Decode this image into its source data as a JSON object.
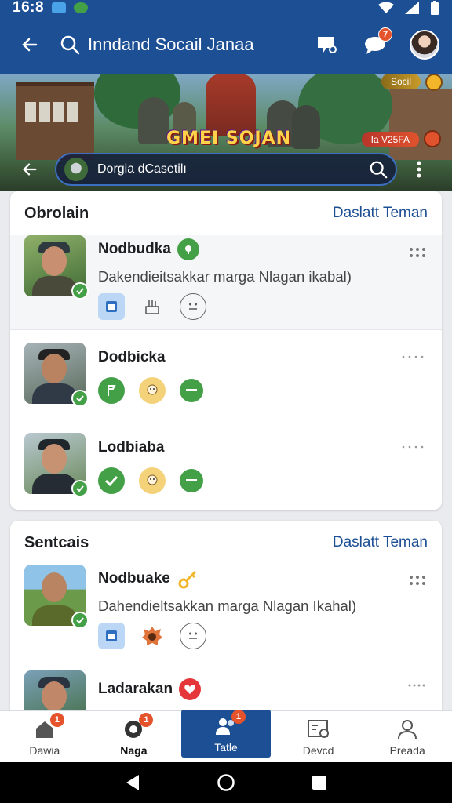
{
  "status_bar": {
    "time": "16:8"
  },
  "app_bar": {
    "title": "Inndand Socail Janaa",
    "notification_badge": "7"
  },
  "banner": {
    "game_title": "GMEI SOJAN",
    "tag_top": "Socil",
    "tag_bottom": "Ia V25FA",
    "search_text": "Dorgia dCasetilı"
  },
  "sections": [
    {
      "title": "Obrolain",
      "link": "Daslatt Teman",
      "friends": [
        {
          "name": "Nodbudka",
          "subtitle": "Dakendieitsakkar marga Nlagan ikabal)"
        },
        {
          "name": "Dodbicka",
          "subtitle": ""
        },
        {
          "name": "Lodbiaba",
          "subtitle": ""
        }
      ]
    },
    {
      "title": "Sentcais",
      "link": "Daslatt Teman",
      "friends": [
        {
          "name": "Nodbuake",
          "subtitle": "Dahendieltsakkan marga Nlagan Ikahal)"
        },
        {
          "name": "Ladarakan",
          "subtitle": ""
        }
      ]
    }
  ],
  "bottom_nav": [
    {
      "label": "Dawia",
      "badge": "1"
    },
    {
      "label": "Naga",
      "badge": "1"
    },
    {
      "label": "Tatle",
      "badge": "1"
    },
    {
      "label": "Devcd",
      "badge": ""
    },
    {
      "label": "Preada",
      "badge": ""
    }
  ],
  "colors": {
    "brand": "#1d4f94",
    "accent_green": "#43a047",
    "badge_red": "#e5532d"
  }
}
